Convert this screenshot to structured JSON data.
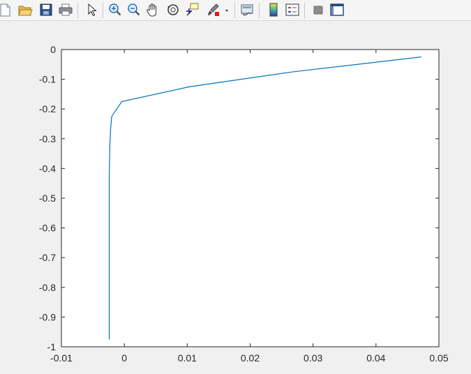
{
  "toolbar": {
    "buttons": [
      {
        "name": "new-figure-icon"
      },
      {
        "name": "open-file-icon"
      },
      {
        "name": "save-icon"
      },
      {
        "name": "print-icon"
      },
      {
        "name": "edit-plot-arrow-icon"
      },
      {
        "name": "zoom-in-icon"
      },
      {
        "name": "zoom-out-icon"
      },
      {
        "name": "pan-hand-icon"
      },
      {
        "name": "rotate-3d-icon"
      },
      {
        "name": "data-cursor-icon"
      },
      {
        "name": "brush-icon"
      },
      {
        "name": "brush-dropdown-icon"
      },
      {
        "name": "link-plot-icon"
      },
      {
        "name": "colorbar-icon"
      },
      {
        "name": "legend-icon"
      },
      {
        "name": "hide-plot-tools-icon"
      },
      {
        "name": "show-plot-tools-icon"
      }
    ]
  },
  "colors": {
    "line": "#0072BD",
    "axes_bg": "#ffffff",
    "figure_bg": "#f0f0f0",
    "axis": "#262626"
  },
  "chart_data": {
    "type": "line",
    "title": "",
    "xlabel": "",
    "ylabel": "",
    "xlim": [
      -0.01,
      0.05
    ],
    "ylim": [
      -1,
      0
    ],
    "xticks": [
      "-0.01",
      "0",
      "0.01",
      "0.02",
      "0.03",
      "0.04",
      "0.05"
    ],
    "yticks": [
      "0",
      "-0.1",
      "-0.2",
      "-0.3",
      "-0.4",
      "-0.5",
      "-0.6",
      "-0.7",
      "-0.8",
      "-0.9",
      "-1"
    ],
    "grid": false,
    "series": [
      {
        "x": [
          0.0472,
          0.0268,
          0.0104,
          -0.0004,
          -0.002,
          -0.0022,
          -0.0023,
          -0.0024,
          -0.0024,
          -0.0024,
          -0.0024,
          -0.0024,
          -0.0024
        ],
        "y": [
          -0.025,
          -0.075,
          -0.125,
          -0.175,
          -0.225,
          -0.275,
          -0.325,
          -0.425,
          -0.525,
          -0.625,
          -0.775,
          -0.875,
          -0.975
        ]
      }
    ]
  }
}
